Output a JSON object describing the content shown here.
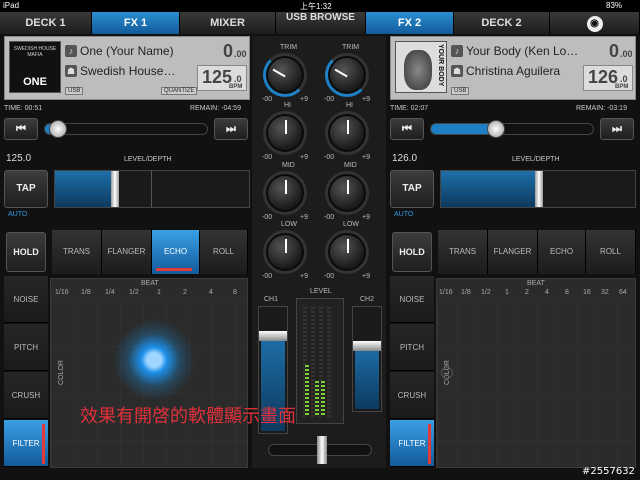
{
  "status": {
    "device": "iPad",
    "time": "上午1:32",
    "battery": "83%"
  },
  "tabs": [
    {
      "label": "DECK 1"
    },
    {
      "label": "FX 1"
    },
    {
      "label": "MIXER"
    },
    {
      "label": "USB BROWSE"
    },
    {
      "label": "FX 2"
    },
    {
      "label": "DECK 2"
    }
  ],
  "deck1": {
    "title": "One (Your Name)",
    "artist": "Swedish House…",
    "art_text": "ONE",
    "art_top": "SWEDISH HOUSE MAFIA",
    "usb": "USB",
    "quantize": "QUANTIZE",
    "level_big": "0",
    "level_small": ".00",
    "bpm": "125",
    "bpm_dec": ".0",
    "bpm_unit": "BPM",
    "time": "TIME: 00:51",
    "remain": "REMAIN: -04:59",
    "tempo": "125.0",
    "level_depth": "LEVEL/DEPTH",
    "tap": "TAP",
    "auto": "AUTO",
    "progress": 0.08
  },
  "deck2": {
    "title": "Your Body (Ken Lo…",
    "artist": "Christina Aguilera",
    "art_text": "YOUR BODY",
    "usb": "USB",
    "level_big": "0",
    "level_small": ".00",
    "bpm": "126",
    "bpm_dec": ".0",
    "bpm_unit": "BPM",
    "time": "TIME: 02:07",
    "remain": "REMAIN: -03:19",
    "tempo": "126.0",
    "level_depth": "LEVEL/DEPTH",
    "tap": "TAP",
    "auto": "AUTO",
    "progress": 0.4
  },
  "mixer": {
    "trim": "TRIM",
    "hi": "HI",
    "mid": "MID",
    "low": "LOW",
    "min": "-00",
    "max": "+9",
    "ch1": "CH1",
    "ch2": "CH2",
    "level": "LEVEL"
  },
  "fx1": {
    "hold": "HOLD",
    "effects": [
      "TRANS",
      "FLANGER",
      "ECHO",
      "ROLL"
    ],
    "active": "ECHO",
    "beat": "BEAT",
    "beats": [
      "1/16",
      "1/8",
      "1/4",
      "1/2",
      "1",
      "2",
      "4",
      "8"
    ],
    "side": [
      "NOISE",
      "PITCH",
      "CRUSH",
      "FILTER"
    ],
    "color": "COLOR"
  },
  "fx2": {
    "hold": "HOLD",
    "effects": [
      "TRANS",
      "FLANGER",
      "ECHO",
      "ROLL"
    ],
    "beat": "BEAT",
    "beats": [
      "1/16",
      "1/8",
      "1/2",
      "1",
      "2",
      "4",
      "8",
      "16",
      "32",
      "64"
    ],
    "side": [
      "NOISE",
      "PITCH",
      "CRUSH",
      "FILTER"
    ],
    "color": "COLOR"
  },
  "overlay": {
    "caption": "效果有開啓的軟體顯示畫面",
    "watermark": "#2557632"
  },
  "colors": {
    "accent": "#1e7fc4",
    "caption": "#e0303a"
  }
}
